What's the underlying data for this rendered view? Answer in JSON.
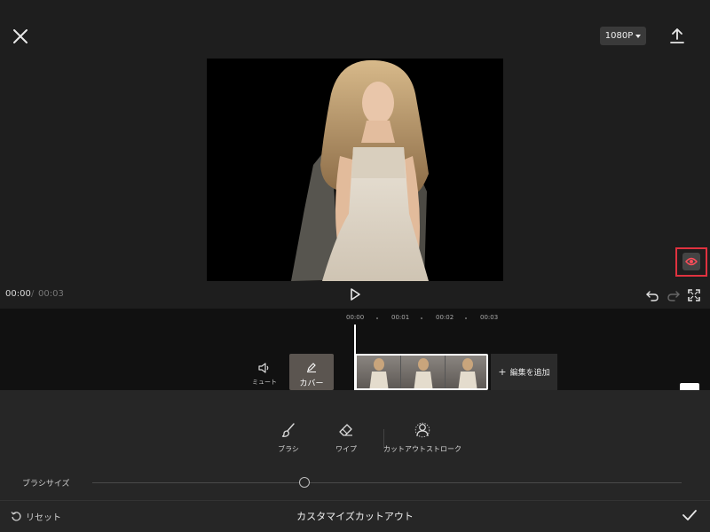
{
  "toolbar": {
    "resolution": "1080P"
  },
  "player": {
    "time_current": "00:00",
    "time_separator": "/",
    "time_total": "00:03"
  },
  "timeline": {
    "ticks": [
      "00:00",
      "00:01",
      "00:02",
      "00:03"
    ],
    "mute_label": "ミュート",
    "cover_label": "カバー",
    "add_edit_label": "編集を追加"
  },
  "tools": [
    {
      "label": "ブラシ",
      "icon": "brush-icon"
    },
    {
      "label": "ワイプ",
      "icon": "eraser-icon"
    },
    {
      "label": "カットアウトストローク",
      "icon": "person-outline-icon"
    }
  ],
  "brush": {
    "size_label": "ブラシサイズ",
    "size_value": 0.36
  },
  "footer": {
    "reset_label": "リセット",
    "title": "カスタマイズカットアウト"
  },
  "colors": {
    "highlight": "#e0323f",
    "background": "#1b1b1b"
  }
}
